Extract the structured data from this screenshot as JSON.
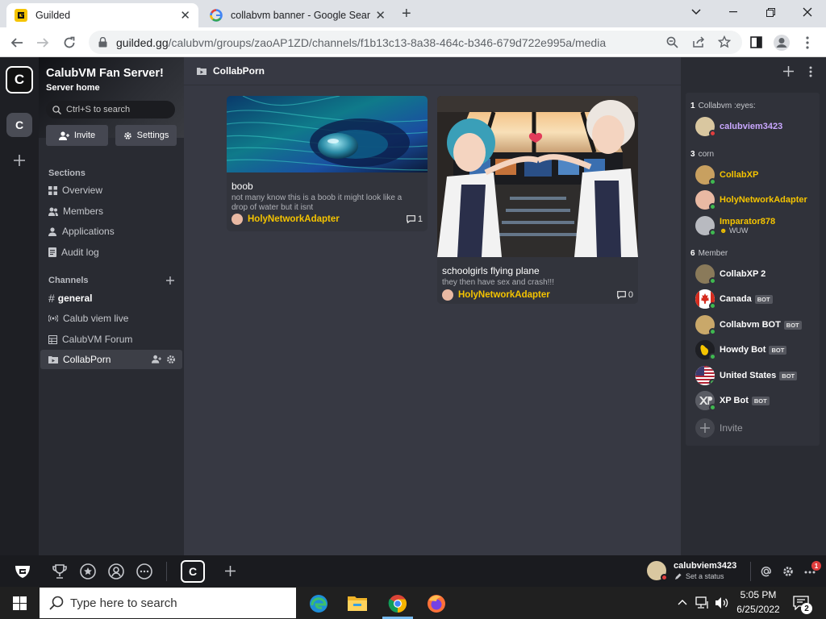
{
  "browser": {
    "tabs": [
      {
        "title": "Guilded"
      },
      {
        "title": "collabvm banner - Google Search"
      }
    ],
    "url_host": "guilded.gg",
    "url_path": "/calubvm/groups/zaoAP1ZD/channels/f1b13c13-8a38-464c-b346-679d722e995a/media"
  },
  "server": {
    "initial": "C",
    "name": "CalubVM Fan Server!",
    "subtitle": "Server home",
    "search_placeholder": "Ctrl+S to search",
    "invite_label": "Invite",
    "settings_label": "Settings"
  },
  "sections": {
    "header": "Sections",
    "items": [
      {
        "label": "Overview"
      },
      {
        "label": "Members"
      },
      {
        "label": "Applications"
      },
      {
        "label": "Audit log"
      }
    ]
  },
  "channels": {
    "header": "Channels",
    "items": [
      {
        "label": "general"
      },
      {
        "label": "Calub viem live"
      },
      {
        "label": "CalubVM Forum"
      },
      {
        "label": "CollabPorn"
      }
    ]
  },
  "channel_title": "CollabPorn",
  "media": [
    {
      "title": "boob",
      "description": "not many know this is a boob it might look like a drop of water but it isnt",
      "author": "HolyNetworkAdapter",
      "comments": "1"
    },
    {
      "title": "schoolgirls flying plane",
      "description": "they then have sex and crash!!!",
      "author": "HolyNetworkAdapter",
      "comments": "0"
    }
  ],
  "member_groups": [
    {
      "count": "1",
      "name": "Collabvm :eyes:"
    },
    {
      "count": "3",
      "name": "corn"
    },
    {
      "count": "6",
      "name": "Member"
    }
  ],
  "members": [
    {
      "name": "calubviem3423"
    },
    {
      "name": "CollabXP"
    },
    {
      "name": "HolyNetworkAdapter"
    },
    {
      "name": "Imparator878",
      "status": "WUW"
    },
    {
      "name": "CollabXP 2"
    },
    {
      "name": "Canada",
      "badge": "BOT"
    },
    {
      "name": "Collabvm BOT",
      "badge": "BOT"
    },
    {
      "name": "Howdy Bot",
      "badge": "BOT"
    },
    {
      "name": "United States",
      "badge": "BOT"
    },
    {
      "name": "XP Bot",
      "badge": "BOT"
    }
  ],
  "invite_member_label": "Invite",
  "user": {
    "name": "calubviem3423",
    "status": "Set a status",
    "notif_count": "1"
  },
  "taskbar": {
    "search_placeholder": "Type here to search",
    "time": "5:05 PM",
    "date": "6/25/2022",
    "notif_count": "2"
  },
  "colors": {
    "accent": "#f5c400",
    "online": "#3fb950",
    "dnd": "#e03e3e"
  }
}
